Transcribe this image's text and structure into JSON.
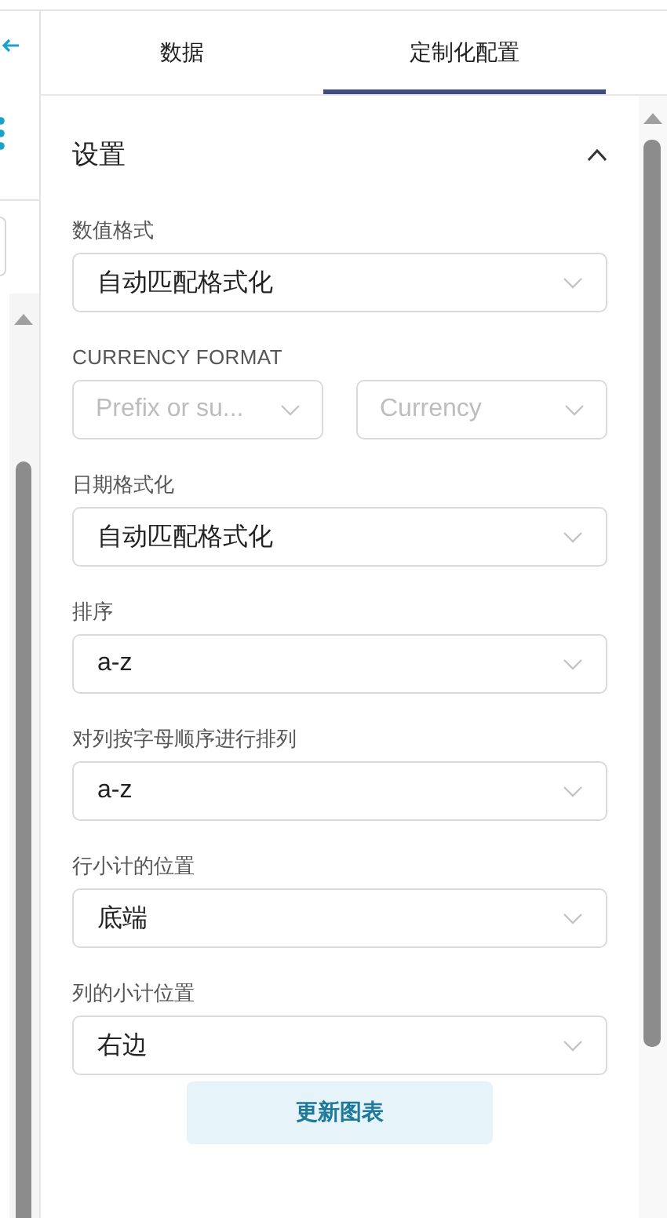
{
  "tabs": [
    {
      "label": "数据",
      "selected": false
    },
    {
      "label": "定制化配置",
      "selected": true
    }
  ],
  "section": {
    "title": "设置",
    "expanded": true
  },
  "fields": [
    {
      "kind": "select",
      "label": "数值格式",
      "value": "自动匹配格式化"
    },
    {
      "kind": "pair",
      "label": "CURRENCY FORMAT",
      "placeholders": [
        "Prefix or su...",
        "Currency"
      ]
    },
    {
      "kind": "select",
      "label": "日期格式化",
      "value": "自动匹配格式化"
    },
    {
      "kind": "select",
      "label": "排序",
      "value": "a-z"
    },
    {
      "kind": "select",
      "label": "对列按字母顺序进行排列",
      "value": "a-z"
    },
    {
      "kind": "select",
      "label": "行小计的位置",
      "value": "底端"
    },
    {
      "kind": "select",
      "label": "列的小计位置",
      "value": "右边"
    }
  ],
  "button": "更新图表"
}
